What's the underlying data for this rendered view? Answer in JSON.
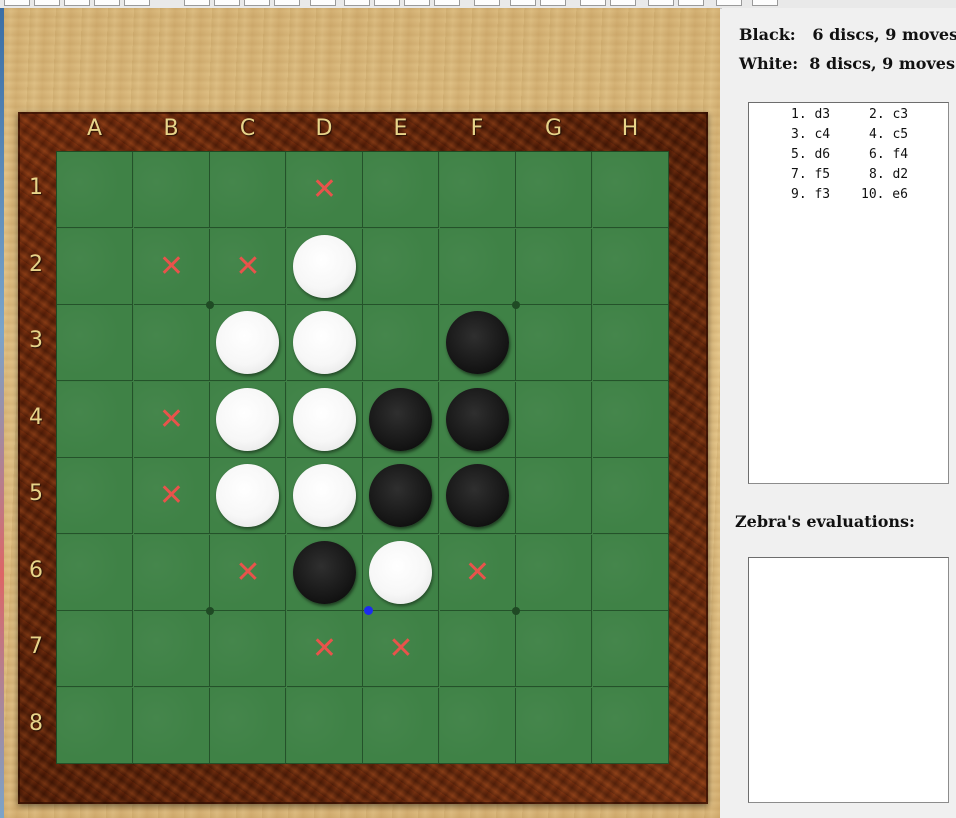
{
  "colors": {
    "board_green": "#3f8246",
    "grid_line": "#24522a",
    "label_gold": "#e7d48a",
    "legal_mark_red": "#e8534b",
    "last_move_dot": "#1d2cf0",
    "frame_wood": "#6a240a"
  },
  "board": {
    "columns": [
      "A",
      "B",
      "C",
      "D",
      "E",
      "F",
      "G",
      "H"
    ],
    "rows": [
      "1",
      "2",
      "3",
      "4",
      "5",
      "6",
      "7",
      "8"
    ],
    "discs": [
      {
        "square": "D2",
        "color": "white"
      },
      {
        "square": "C3",
        "color": "white"
      },
      {
        "square": "D3",
        "color": "white"
      },
      {
        "square": "F3",
        "color": "black"
      },
      {
        "square": "C4",
        "color": "white"
      },
      {
        "square": "D4",
        "color": "white"
      },
      {
        "square": "E4",
        "color": "black"
      },
      {
        "square": "F4",
        "color": "black"
      },
      {
        "square": "C5",
        "color": "white"
      },
      {
        "square": "D5",
        "color": "white"
      },
      {
        "square": "E5",
        "color": "black"
      },
      {
        "square": "F5",
        "color": "black"
      },
      {
        "square": "D6",
        "color": "black"
      },
      {
        "square": "E6",
        "color": "white"
      }
    ],
    "legal_moves": [
      "D1",
      "B2",
      "C2",
      "B4",
      "B5",
      "C6",
      "F6",
      "D7",
      "E7"
    ],
    "legal_move_symbol": "✕",
    "last_move": "E6"
  },
  "status": {
    "black": "Black:   6 discs, 9 moves",
    "white": "White:  8 discs, 9 moves"
  },
  "moves": [
    [
      "1. d3",
      "2. c3"
    ],
    [
      "3. c4",
      "4. c5"
    ],
    [
      "5. d6",
      "6. f4"
    ],
    [
      "7. f5",
      "8. d2"
    ],
    [
      "9. f3",
      "10. e6"
    ]
  ],
  "evaluations": {
    "label": "Zebra's evaluations:"
  }
}
